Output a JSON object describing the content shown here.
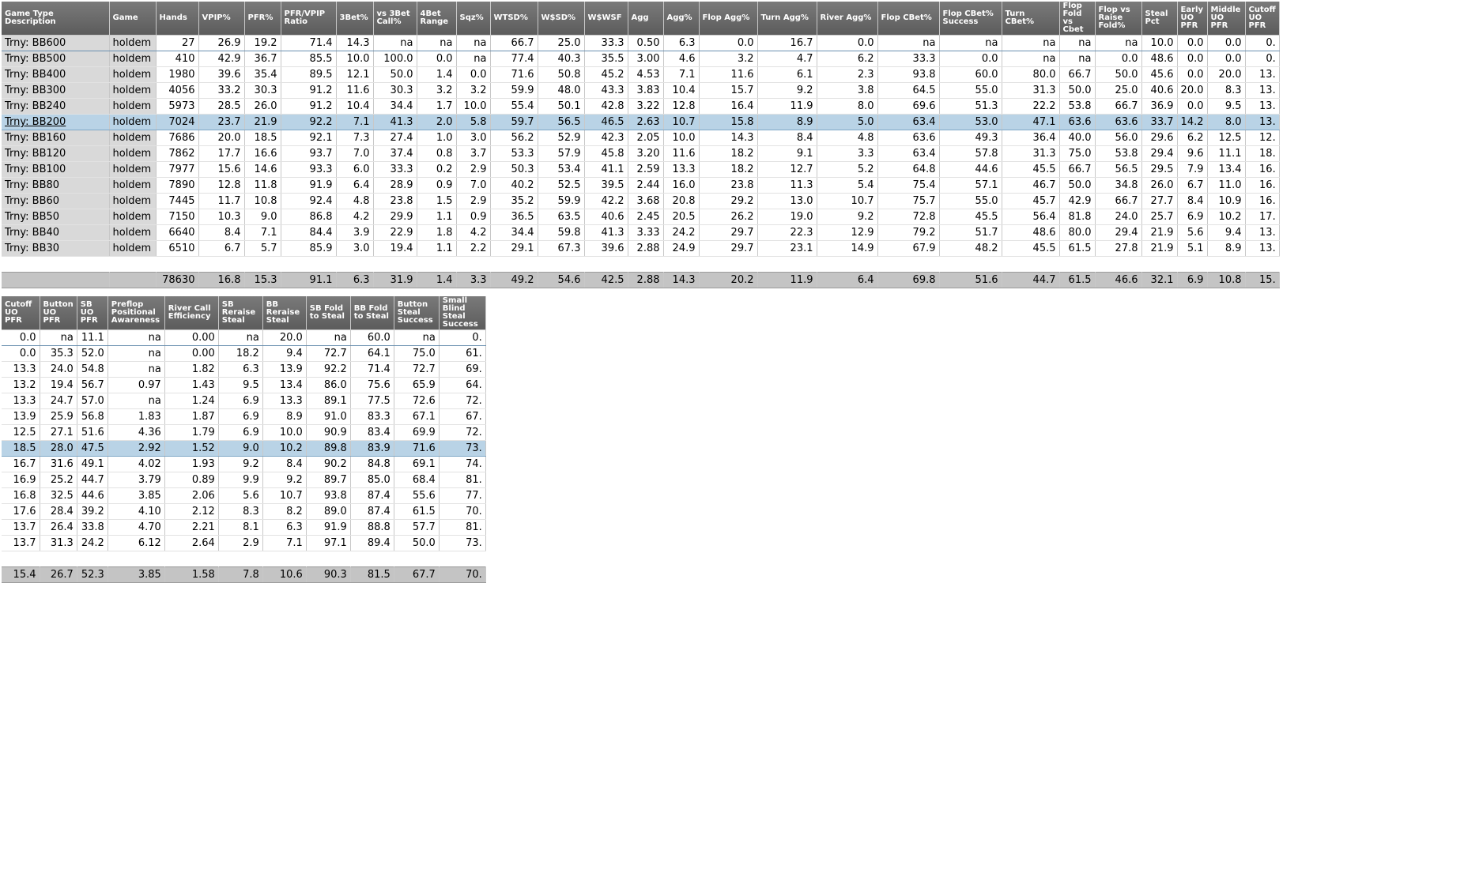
{
  "main_table": {
    "columns": [
      "Game Type Description",
      "Game",
      "Hands",
      "VPIP%",
      "PFR%",
      "PFR/VPIP Ratio",
      "3Bet%",
      "vs 3Bet Call%",
      "4Bet Range",
      "Sqz%",
      "WTSD%",
      "W$SD%",
      "W$WSF",
      "Agg",
      "Agg%",
      "Flop Agg%",
      "Turn Agg%",
      "River Agg%",
      "Flop CBet%",
      "Flop CBet% Success",
      "Turn CBet%",
      "Flop Fold vs Cbet",
      "Flop vs Raise Fold%",
      "Steal Pct",
      "Early UO PFR",
      "Middle UO PFR",
      "Cutoff UO PFR"
    ],
    "rows": [
      [
        "Trny: BB600",
        "holdem",
        "27",
        "26.9",
        "19.2",
        "71.4",
        "14.3",
        "na",
        "na",
        "na",
        "66.7",
        "25.0",
        "33.3",
        "0.50",
        "6.3",
        "0.0",
        "16.7",
        "0.0",
        "na",
        "na",
        "na",
        "na",
        "na",
        "10.0",
        "0.0",
        "0.0",
        "0."
      ],
      [
        "Trny: BB500",
        "holdem",
        "410",
        "42.9",
        "36.7",
        "85.5",
        "10.0",
        "100.0",
        "0.0",
        "na",
        "77.4",
        "40.3",
        "35.5",
        "3.00",
        "4.6",
        "3.2",
        "4.7",
        "6.2",
        "33.3",
        "0.0",
        "na",
        "na",
        "0.0",
        "48.6",
        "0.0",
        "0.0",
        "0."
      ],
      [
        "Trny: BB400",
        "holdem",
        "1980",
        "39.6",
        "35.4",
        "89.5",
        "12.1",
        "50.0",
        "1.4",
        "0.0",
        "71.6",
        "50.8",
        "45.2",
        "4.53",
        "7.1",
        "11.6",
        "6.1",
        "2.3",
        "93.8",
        "60.0",
        "80.0",
        "66.7",
        "50.0",
        "45.6",
        "0.0",
        "20.0",
        "13."
      ],
      [
        "Trny: BB300",
        "holdem",
        "4056",
        "33.2",
        "30.3",
        "91.2",
        "11.6",
        "30.3",
        "3.2",
        "3.2",
        "59.9",
        "48.0",
        "43.3",
        "3.83",
        "10.4",
        "15.7",
        "9.2",
        "3.8",
        "64.5",
        "55.0",
        "31.3",
        "50.0",
        "25.0",
        "40.6",
        "20.0",
        "8.3",
        "13."
      ],
      [
        "Trny: BB240",
        "holdem",
        "5973",
        "28.5",
        "26.0",
        "91.2",
        "10.4",
        "34.4",
        "1.7",
        "10.0",
        "55.4",
        "50.1",
        "42.8",
        "3.22",
        "12.8",
        "16.4",
        "11.9",
        "8.0",
        "69.6",
        "51.3",
        "22.2",
        "53.8",
        "66.7",
        "36.9",
        "0.0",
        "9.5",
        "13."
      ],
      [
        "Trny: BB200",
        "holdem",
        "7024",
        "23.7",
        "21.9",
        "92.2",
        "7.1",
        "41.3",
        "2.0",
        "5.8",
        "59.7",
        "56.5",
        "46.5",
        "2.63",
        "10.7",
        "15.8",
        "8.9",
        "5.0",
        "63.4",
        "53.0",
        "47.1",
        "63.6",
        "63.6",
        "33.7",
        "14.2",
        "8.0",
        "13."
      ],
      [
        "Trny: BB160",
        "holdem",
        "7686",
        "20.0",
        "18.5",
        "92.1",
        "7.3",
        "27.4",
        "1.0",
        "3.0",
        "56.2",
        "52.9",
        "42.3",
        "2.05",
        "10.0",
        "14.3",
        "8.4",
        "4.8",
        "63.6",
        "49.3",
        "36.4",
        "40.0",
        "56.0",
        "29.6",
        "6.2",
        "12.5",
        "12."
      ],
      [
        "Trny: BB120",
        "holdem",
        "7862",
        "17.7",
        "16.6",
        "93.7",
        "7.0",
        "37.4",
        "0.8",
        "3.7",
        "53.3",
        "57.9",
        "45.8",
        "3.20",
        "11.6",
        "18.2",
        "9.1",
        "3.3",
        "63.4",
        "57.8",
        "31.3",
        "75.0",
        "53.8",
        "29.4",
        "9.6",
        "11.1",
        "18."
      ],
      [
        "Trny: BB100",
        "holdem",
        "7977",
        "15.6",
        "14.6",
        "93.3",
        "6.0",
        "33.3",
        "0.2",
        "2.9",
        "50.3",
        "53.4",
        "41.1",
        "2.59",
        "13.3",
        "18.2",
        "12.7",
        "5.2",
        "64.8",
        "44.6",
        "45.5",
        "66.7",
        "56.5",
        "29.5",
        "7.9",
        "13.4",
        "16."
      ],
      [
        "Trny: BB80",
        "holdem",
        "7890",
        "12.8",
        "11.8",
        "91.9",
        "6.4",
        "28.9",
        "0.9",
        "7.0",
        "40.2",
        "52.5",
        "39.5",
        "2.44",
        "16.0",
        "23.8",
        "11.3",
        "5.4",
        "75.4",
        "57.1",
        "46.7",
        "50.0",
        "34.8",
        "26.0",
        "6.7",
        "11.0",
        "16."
      ],
      [
        "Trny: BB60",
        "holdem",
        "7445",
        "11.7",
        "10.8",
        "92.4",
        "4.8",
        "23.8",
        "1.5",
        "2.9",
        "35.2",
        "59.9",
        "42.2",
        "3.68",
        "20.8",
        "29.2",
        "13.0",
        "10.7",
        "75.7",
        "55.0",
        "45.7",
        "42.9",
        "66.7",
        "27.7",
        "8.4",
        "10.9",
        "16."
      ],
      [
        "Trny: BB50",
        "holdem",
        "7150",
        "10.3",
        "9.0",
        "86.8",
        "4.2",
        "29.9",
        "1.1",
        "0.9",
        "36.5",
        "63.5",
        "40.6",
        "2.45",
        "20.5",
        "26.2",
        "19.0",
        "9.2",
        "72.8",
        "45.5",
        "56.4",
        "81.8",
        "24.0",
        "25.7",
        "6.9",
        "10.2",
        "17."
      ],
      [
        "Trny: BB40",
        "holdem",
        "6640",
        "8.4",
        "7.1",
        "84.4",
        "3.9",
        "22.9",
        "1.8",
        "4.2",
        "34.4",
        "59.8",
        "41.3",
        "3.33",
        "24.2",
        "29.7",
        "22.3",
        "12.9",
        "79.2",
        "51.7",
        "48.6",
        "80.0",
        "29.4",
        "21.9",
        "5.6",
        "9.4",
        "13."
      ],
      [
        "Trny: BB30",
        "holdem",
        "6510",
        "6.7",
        "5.7",
        "85.9",
        "3.0",
        "19.4",
        "1.1",
        "2.2",
        "29.1",
        "67.3",
        "39.6",
        "2.88",
        "24.9",
        "29.7",
        "23.1",
        "14.9",
        "67.9",
        "48.2",
        "45.5",
        "61.5",
        "27.8",
        "21.9",
        "5.1",
        "8.9",
        "13."
      ]
    ],
    "totals": [
      "",
      "",
      "78630",
      "16.8",
      "15.3",
      "91.1",
      "6.3",
      "31.9",
      "1.4",
      "3.3",
      "49.2",
      "54.6",
      "42.5",
      "2.88",
      "14.3",
      "20.2",
      "11.9",
      "6.4",
      "69.8",
      "51.6",
      "44.7",
      "61.5",
      "46.6",
      "32.1",
      "6.9",
      "10.8",
      "15."
    ]
  },
  "second_table": {
    "columns": [
      "Cutoff UO PFR",
      "Button UO PFR",
      "SB UO PFR",
      "Preflop Positional Awareness",
      "River Call Efficiency",
      "SB Reraise Steal",
      "BB Reraise Steal",
      "SB Fold to Steal",
      "BB Fold to Steal",
      "Button Steal Success",
      "Small Blind Steal Success"
    ],
    "rows": [
      [
        "0.0",
        "na",
        "11.1",
        "na",
        "0.00",
        "na",
        "20.0",
        "na",
        "60.0",
        "na",
        "0."
      ],
      [
        "0.0",
        "35.3",
        "52.0",
        "na",
        "0.00",
        "18.2",
        "9.4",
        "72.7",
        "64.1",
        "75.0",
        "61."
      ],
      [
        "13.3",
        "24.0",
        "54.8",
        "na",
        "1.82",
        "6.3",
        "13.9",
        "92.2",
        "71.4",
        "72.7",
        "69."
      ],
      [
        "13.2",
        "19.4",
        "56.7",
        "0.97",
        "1.43",
        "9.5",
        "13.4",
        "86.0",
        "75.6",
        "65.9",
        "64."
      ],
      [
        "13.3",
        "24.7",
        "57.0",
        "na",
        "1.24",
        "6.9",
        "13.3",
        "89.1",
        "77.5",
        "72.6",
        "72."
      ],
      [
        "13.9",
        "25.9",
        "56.8",
        "1.83",
        "1.87",
        "6.9",
        "8.9",
        "91.0",
        "83.3",
        "67.1",
        "67."
      ],
      [
        "12.5",
        "27.1",
        "51.6",
        "4.36",
        "1.79",
        "6.9",
        "10.0",
        "90.9",
        "83.4",
        "69.9",
        "72."
      ],
      [
        "18.5",
        "28.0",
        "47.5",
        "2.92",
        "1.52",
        "9.0",
        "10.2",
        "89.8",
        "83.9",
        "71.6",
        "73."
      ],
      [
        "16.7",
        "31.6",
        "49.1",
        "4.02",
        "1.93",
        "9.2",
        "8.4",
        "90.2",
        "84.8",
        "69.1",
        "74."
      ],
      [
        "16.9",
        "25.2",
        "44.7",
        "3.79",
        "0.89",
        "9.9",
        "9.2",
        "89.7",
        "85.0",
        "68.4",
        "81."
      ],
      [
        "16.8",
        "32.5",
        "44.6",
        "3.85",
        "2.06",
        "5.6",
        "10.7",
        "93.8",
        "87.4",
        "55.6",
        "77."
      ],
      [
        "17.6",
        "28.4",
        "39.2",
        "4.10",
        "2.12",
        "8.3",
        "8.2",
        "89.0",
        "87.4",
        "61.5",
        "70."
      ],
      [
        "13.7",
        "26.4",
        "33.8",
        "4.70",
        "2.21",
        "8.1",
        "6.3",
        "91.9",
        "88.8",
        "57.7",
        "81."
      ],
      [
        "13.7",
        "31.3",
        "24.2",
        "6.12",
        "2.64",
        "2.9",
        "7.1",
        "97.1",
        "89.4",
        "50.0",
        "73."
      ]
    ],
    "totals": [
      "15.4",
      "26.7",
      "52.3",
      "3.85",
      "1.58",
      "7.8",
      "10.6",
      "90.3",
      "81.5",
      "67.7",
      "70."
    ]
  }
}
